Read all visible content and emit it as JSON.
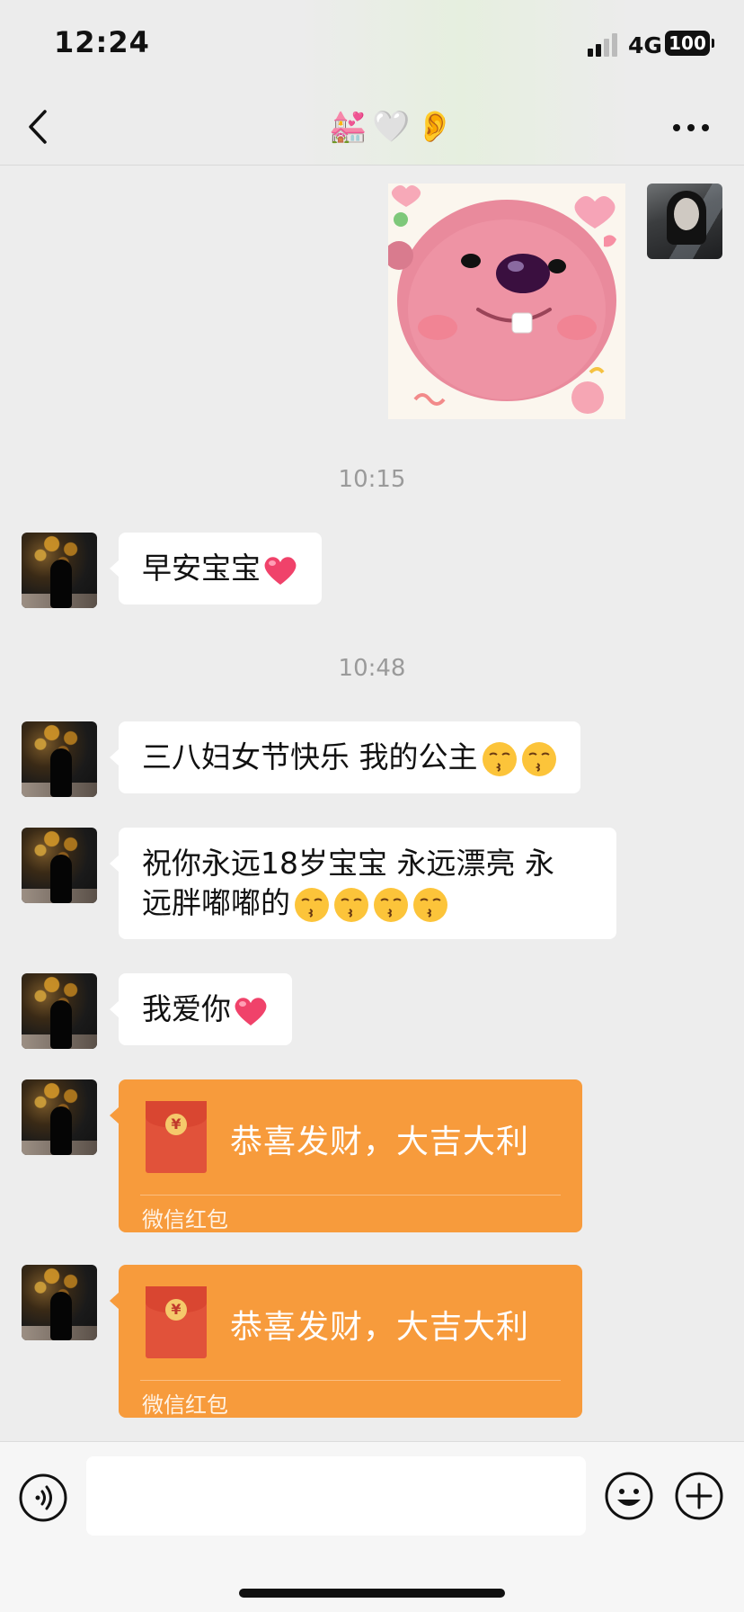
{
  "status_bar": {
    "time": "12:24",
    "network": "4G",
    "battery": "100"
  },
  "header": {
    "title_icons": [
      "wedding-chapel-emoji",
      "white-heart-emoji",
      "ear-emoji"
    ],
    "title_glyphs": [
      "💒",
      "🤍",
      "👂"
    ]
  },
  "messages": {
    "time_1": "10:15",
    "msg_1": "早安宝宝",
    "time_2": "10:48",
    "msg_2": "三八妇女节快乐 我的公主",
    "msg_3_line1": "祝你永远18岁宝宝 永远漂亮 永",
    "msg_3_line2": "远胖嘟嘟的",
    "msg_4": "我爱你"
  },
  "red_packets": [
    {
      "title": "恭喜发财，大吉大利",
      "label": "微信红包",
      "coin": "¥"
    },
    {
      "title": "恭喜发财，大吉大利",
      "label": "微信红包",
      "coin": "¥"
    }
  ],
  "input": {
    "placeholder": ""
  },
  "colors": {
    "chat_background": "#ededed",
    "red_packet": "#f79b3c",
    "envelope": "#e1523a"
  }
}
